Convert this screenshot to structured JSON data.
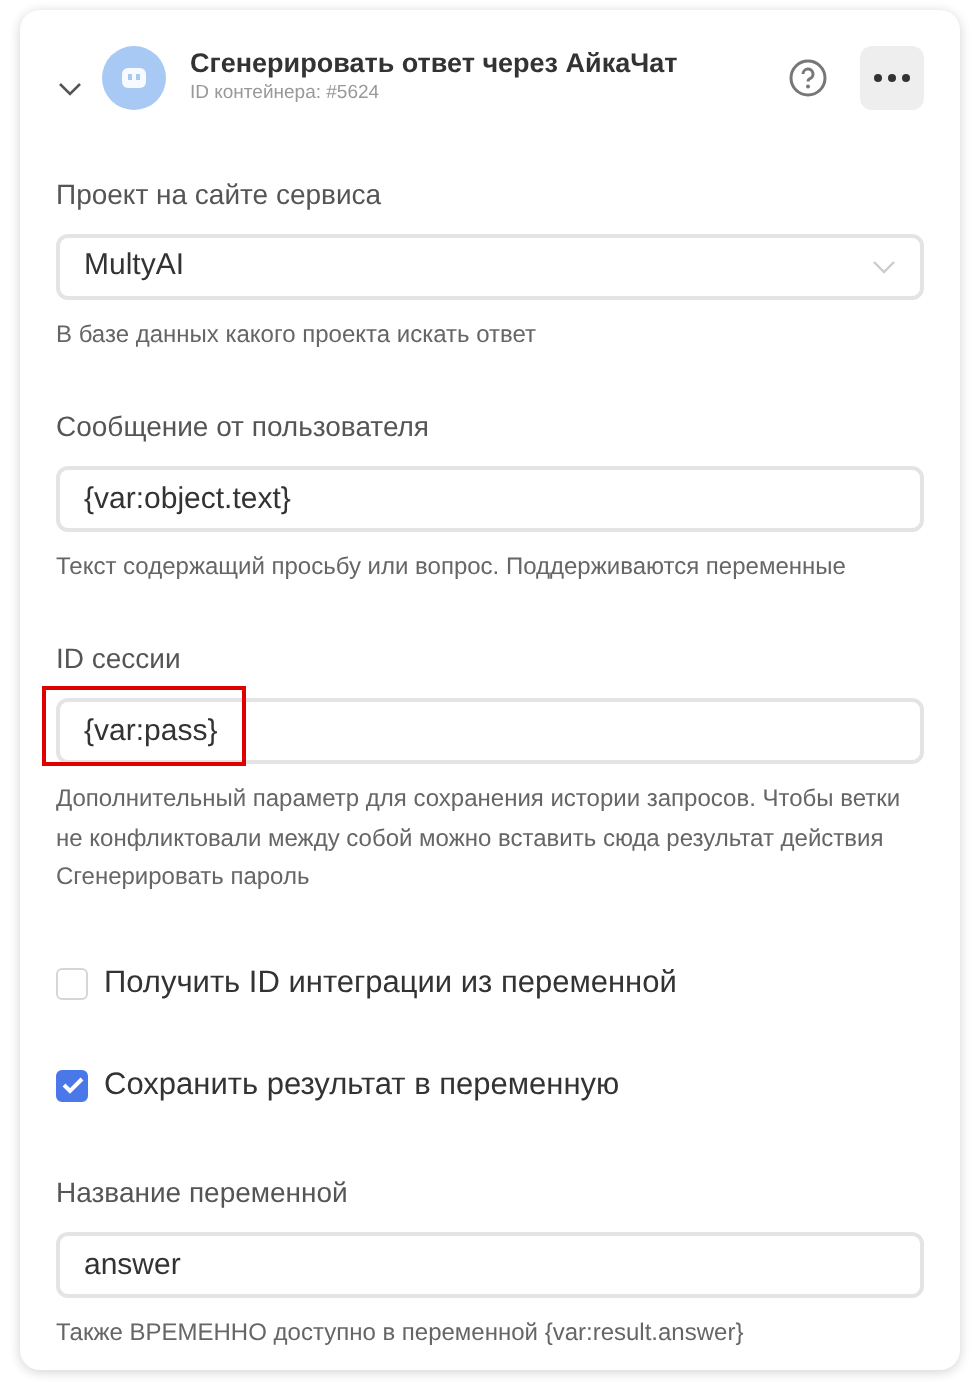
{
  "header": {
    "expanded": true,
    "title": "Сгенерировать ответ через АйкаЧат",
    "subtitle": "ID контейнера: #5624"
  },
  "items": [
    {
      "kind": "select",
      "label": "Проект на сайте сервиса",
      "value": "MultyAI",
      "hint": "В базе данных какого проекта искать ответ",
      "highlighted": false
    },
    {
      "kind": "text",
      "label": "Сообщение от пользователя",
      "value": "{var:object.text}",
      "hint": "Текст содержащий просьбу или вопрос. Поддерживаются переменные",
      "highlighted": false
    },
    {
      "kind": "text",
      "label": "ID сессии",
      "value": "{var:pass}",
      "hint": "Дополнительный параметр для сохранения истории запросов. Чтобы ветки не конфликтовали между собой можно вставить сюда результат действия Сгенерировать пароль",
      "highlighted": true
    },
    {
      "kind": "checkbox",
      "label": "Получить ID интеграции из переменной",
      "checked": false
    },
    {
      "kind": "checkbox",
      "label": "Сохранить результат в переменную",
      "checked": true
    },
    {
      "kind": "text",
      "label": "Название переменной",
      "value": "answer",
      "hint": "Также ВРЕМЕННО доступно в переменной {var:result.answer}",
      "highlighted": false
    }
  ]
}
